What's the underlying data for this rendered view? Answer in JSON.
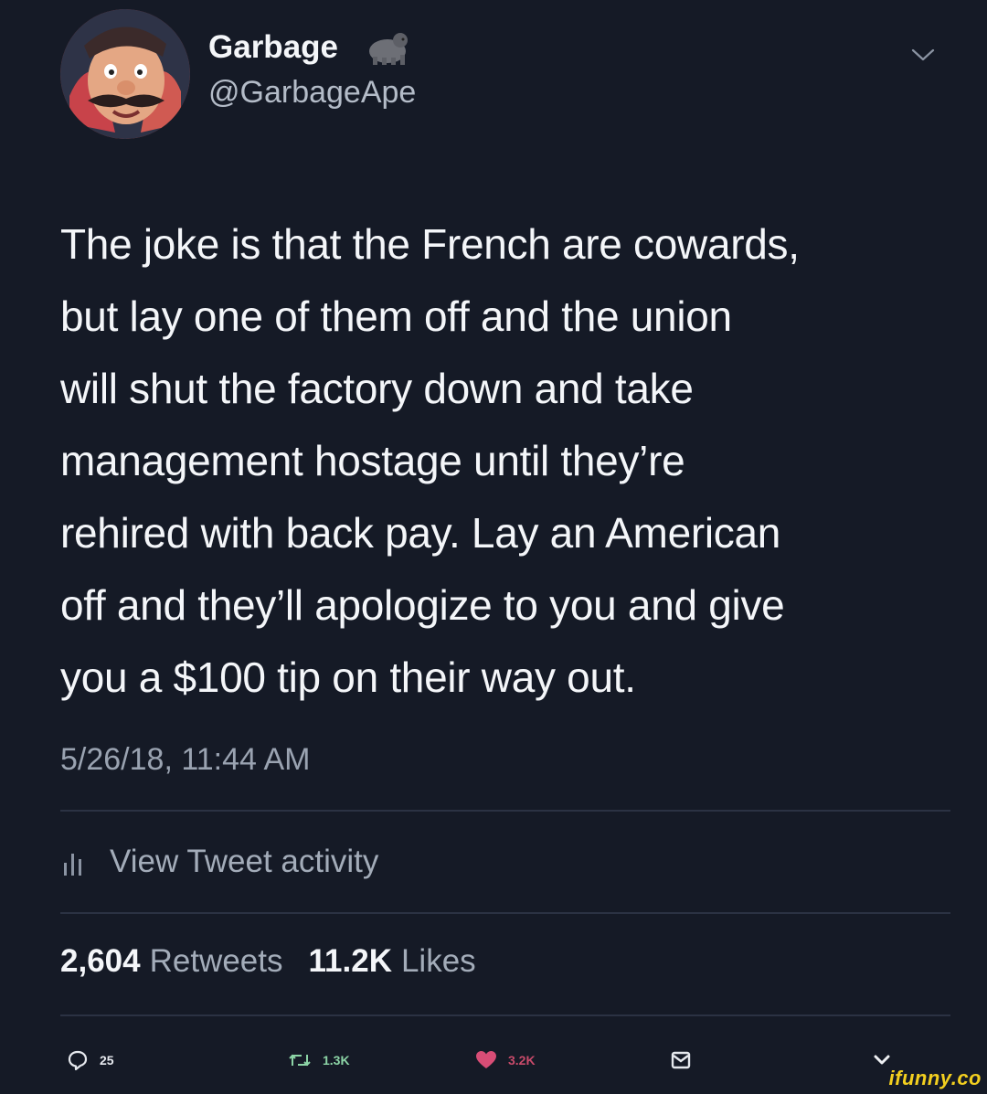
{
  "user": {
    "display_name": "Garbage",
    "username": "@GarbageApe",
    "name_emoji": "gorilla-icon",
    "avatar": "avatar-mustache-man"
  },
  "tweet": {
    "lines": [
      "The joke is that the French are cowards,",
      "but lay one of them off and the union",
      "will shut the factory down and take",
      "management hostage until they’re",
      "rehired with back pay. Lay an American",
      "off and they’ll apologize to you and give",
      "you a $100 tip on their way out."
    ],
    "timestamp": "5/26/18, 11:44 AM"
  },
  "activity": {
    "label": "View Tweet activity",
    "icon": "bar-chart-icon"
  },
  "stats": {
    "retweets_count": "2,604",
    "retweets_label": "Retweets",
    "likes_count": "11.2K",
    "likes_label": "Likes"
  },
  "actions": {
    "reply_count": "25",
    "retweet_count": "1.3K",
    "like_count": "3.2K"
  },
  "watermark": "ifunny.co",
  "colors": {
    "background": "#151a26",
    "retweet_green": "#8cd4a6",
    "like_red": "#c84a6a",
    "watermark_yellow": "#f3cf1f"
  }
}
